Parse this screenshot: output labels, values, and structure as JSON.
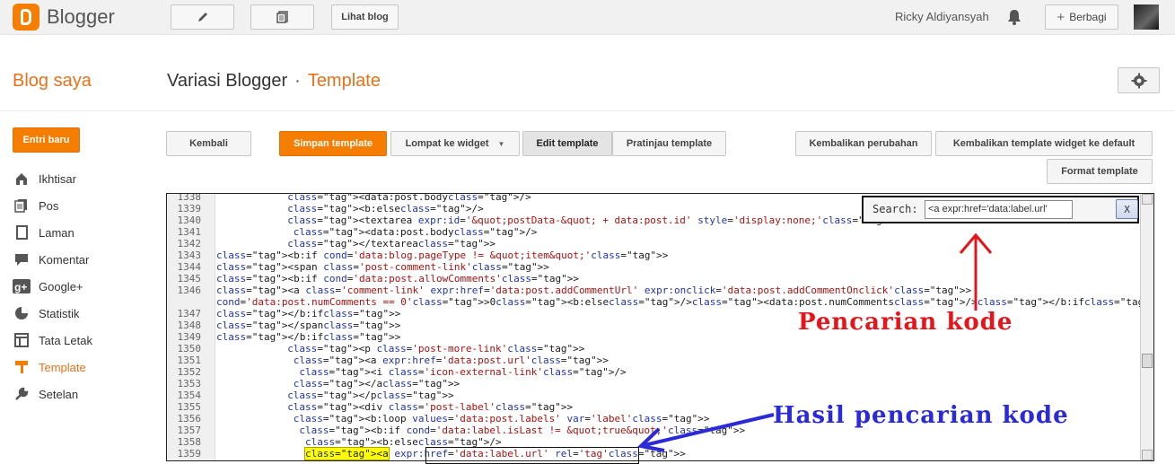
{
  "topbar": {
    "brand": "Blogger",
    "view_blog": "Lihat blog",
    "user_name": "Ricky Aldiyansyah",
    "share_label": "Berbagi"
  },
  "header": {
    "blog_list": "Blog saya",
    "blog_name": "Variasi Blogger",
    "separator": "·",
    "page": "Template"
  },
  "sidebar": {
    "new_post": "Entri baru",
    "items": [
      {
        "label": "Ikhtisar",
        "icon": "overview-icon"
      },
      {
        "label": "Pos",
        "icon": "posts-icon"
      },
      {
        "label": "Laman",
        "icon": "pages-icon"
      },
      {
        "label": "Komentar",
        "icon": "comments-icon"
      },
      {
        "label": "Google+",
        "icon": "google-plus-icon"
      },
      {
        "label": "Statistik",
        "icon": "stats-icon"
      },
      {
        "label": "Tata Letak",
        "icon": "layout-icon"
      },
      {
        "label": "Template",
        "icon": "template-icon"
      },
      {
        "label": "Setelan",
        "icon": "settings-wrench-icon"
      }
    ]
  },
  "toolbar": {
    "back": "Kembali",
    "save": "Simpan template",
    "jump": "Lompat ke widget",
    "edit": "Edit template",
    "preview": "Pratinjau template",
    "revert": "Kembalikan perubahan",
    "revert_widgets": "Kembalikan template widget ke default",
    "format": "Format template"
  },
  "search": {
    "label": "Search:",
    "value": "<a expr:href='data:label.url'",
    "close": "X"
  },
  "annotations": {
    "search_note": "Pencarian kode",
    "result_note": "Hasil pencarian kode"
  },
  "colors": {
    "accent": "#f57d00",
    "annotation_red": "#e8141c",
    "annotation_blue": "#2a2ad8",
    "highlight": "#ffff00"
  },
  "editor": {
    "lines": [
      {
        "n": "1338",
        "indent": 24,
        "code": "<data:post.body/>"
      },
      {
        "n": "1339",
        "indent": 24,
        "code": "<b:else/>"
      },
      {
        "n": "1340",
        "indent": 24,
        "code": "<textarea expr:id='&quot;postData-&quot; + data:post.id' style='display:none;'>"
      },
      {
        "n": "1341",
        "indent": 26,
        "code": "<data:post.body/>"
      },
      {
        "n": "1342",
        "indent": 24,
        "code": "</textarea>"
      },
      {
        "n": "1343",
        "indent": 0,
        "code": "<b:if cond='data:blog.pageType != &quot;item&quot;'>"
      },
      {
        "n": "1344",
        "indent": 0,
        "code": "<span class='post-comment-link'>"
      },
      {
        "n": "1345",
        "indent": 0,
        "code": "<b:if cond='data:post.allowComments'>"
      },
      {
        "n": "1346",
        "indent": 0,
        "code": "<a class='comment-link' expr:href='data:post.addCommentUrl' expr:onclick='data:post.addCommentOnclick'>"
      },
      {
        "n": "",
        "indent": 0,
        "code": "cond='data:post.numComments == 0'>0<b:else/><data:post.numComments/></b:if></a>"
      },
      {
        "n": "1347",
        "indent": 0,
        "code": "</b:if>"
      },
      {
        "n": "1348",
        "indent": 0,
        "code": "</span>"
      },
      {
        "n": "1349",
        "indent": 0,
        "code": "</b:if>"
      },
      {
        "n": "1350",
        "indent": 24,
        "code": "<p class='post-more-link'>"
      },
      {
        "n": "1351",
        "indent": 26,
        "code": "<a expr:href='data:post.url'>"
      },
      {
        "n": "1352",
        "indent": 28,
        "code": "<i class='icon-external-link'/>"
      },
      {
        "n": "1353",
        "indent": 26,
        "code": "</a>"
      },
      {
        "n": "1354",
        "indent": 24,
        "code": "</p>"
      },
      {
        "n": "1355",
        "indent": 24,
        "code": "<div class='post-label'>"
      },
      {
        "n": "1356",
        "indent": 26,
        "code": "<b:loop values='data:post.labels' var='label'>"
      },
      {
        "n": "1357",
        "indent": 28,
        "code": "<b:if cond='data:label.isLast != &quot;true&quot;'>"
      },
      {
        "n": "1358",
        "indent": 30,
        "code": "<b:else/>"
      },
      {
        "n": "1359",
        "indent": 30,
        "code": "<a expr:href='data:label.url' rel='tag'>",
        "highlight": "<a expr:href='data:label.url'"
      }
    ]
  }
}
